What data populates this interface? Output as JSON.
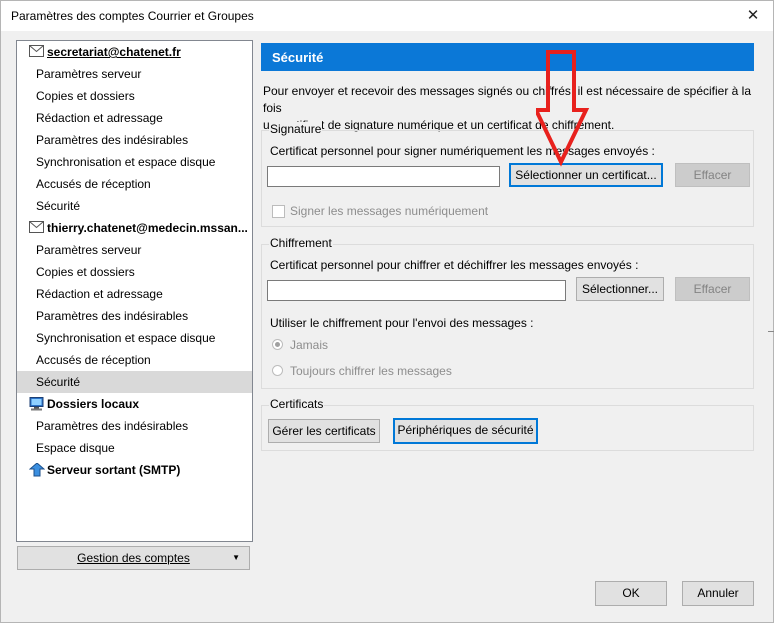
{
  "window": {
    "title": "Paramètres des comptes Courrier et Groupes",
    "close_glyph": "✕"
  },
  "tree": {
    "account1": {
      "label": "secretariat@chatenet.fr",
      "items": [
        "Paramètres serveur",
        "Copies et dossiers",
        "Rédaction et adressage",
        "Paramètres des indésirables",
        "Synchronisation et espace disque",
        "Accusés de réception",
        "Sécurité"
      ]
    },
    "account2": {
      "label": "thierry.chatenet@medecin.mssan...",
      "items": [
        "Paramètres serveur",
        "Copies et dossiers",
        "Rédaction et adressage",
        "Paramètres des indésirables",
        "Synchronisation et espace disque",
        "Accusés de réception",
        "Sécurité"
      ]
    },
    "local": {
      "label": "Dossiers locaux",
      "items": [
        "Paramètres des indésirables",
        "Espace disque"
      ]
    },
    "smtp": {
      "label": "Serveur sortant (SMTP)"
    }
  },
  "manage_button": {
    "label": "Gestion des comptes",
    "caret": "▼"
  },
  "security": {
    "header": "Sécurité",
    "description_line1": "Pour envoyer et recevoir des messages signés ou chiffrés, il est nécessaire de spécifier à la fois",
    "description_line2": "un certificat de signature numérique et un certificat de chiffrement.",
    "signature": {
      "legend": "Signature",
      "label": "Certificat personnel pour signer numériquement les messages envoyés :",
      "input_value": "",
      "select_button": "Sélectionner un certificat...",
      "clear_button": "Effacer",
      "sign_checkbox": "Signer les messages numériquement"
    },
    "encryption": {
      "legend": "Chiffrement",
      "label": "Certificat personnel pour chiffrer et déchiffrer les messages envoyés :",
      "input_value": "",
      "select_button": "Sélectionner...",
      "clear_button": "Effacer",
      "use_label": "Utiliser le chiffrement pour l'envoi des messages :",
      "radio_never": "Jamais",
      "radio_always": "Toujours chiffrer les messages"
    },
    "certificates": {
      "legend": "Certificats",
      "manage_button": "Gérer les certificats",
      "devices_button": "Périphériques de sécurité"
    }
  },
  "buttons": {
    "ok": "OK",
    "cancel": "Annuler"
  },
  "colors": {
    "header_bg": "#0b78d7",
    "arrow": "#e8211d",
    "selected_row": "#d9d9d9"
  }
}
